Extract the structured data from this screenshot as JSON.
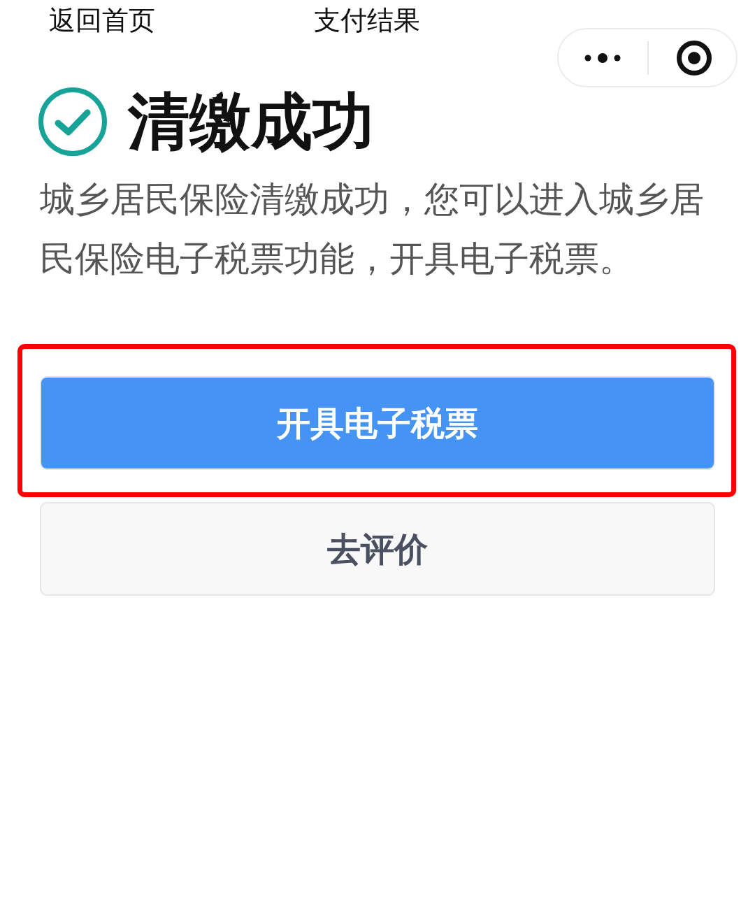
{
  "nav_bar": {
    "back_link": "返回首页",
    "title": "支付结果"
  },
  "result": {
    "kind": "success",
    "title": "清缴成功",
    "message": "城乡居民保险清缴成功，您可以进入城乡居民保险电子税票功能，开具电子税票。"
  },
  "buttons": [
    {
      "label": "开具电子税票",
      "kind": "primary",
      "highlighted": true
    },
    {
      "label": "去评价",
      "kind": "secondary",
      "highlighted": false
    }
  ]
}
